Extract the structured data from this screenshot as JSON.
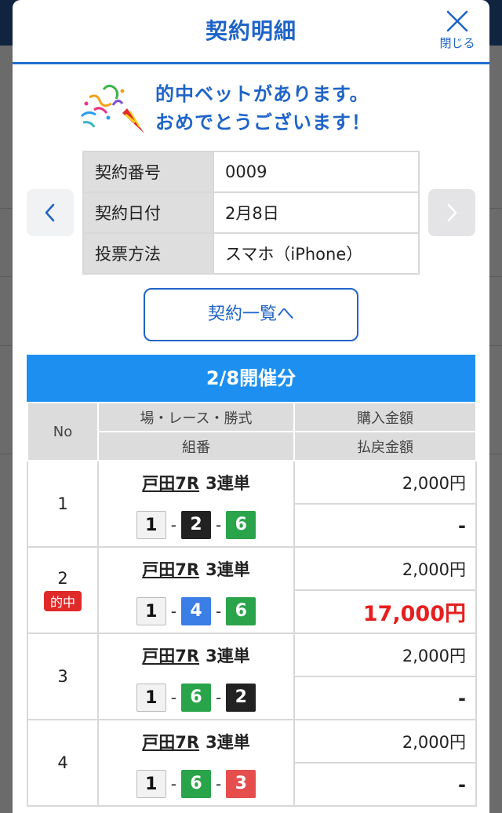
{
  "modal": {
    "title": "契約明細",
    "close_label": "閉じる"
  },
  "celebration": {
    "line1": "的中ベットがあります。",
    "line2": "おめでとうございます！"
  },
  "contract_info": {
    "rows": [
      {
        "label": "契約番号",
        "value": "0009"
      },
      {
        "label": "契約日付",
        "value": "2月8日"
      },
      {
        "label": "投票方法",
        "value": "スマホ（iPhone）"
      }
    ]
  },
  "list_button": "契約一覧へ",
  "session_title": "2/8開催分",
  "table_headers": {
    "no": "No",
    "venue": "場・レース・勝式",
    "combination": "組番",
    "purchase": "購入金額",
    "payout": "払戻金額"
  },
  "bets": [
    {
      "no": "1",
      "race": "戸田7R",
      "type": "3連単",
      "combo": [
        "1",
        "2",
        "6"
      ],
      "purchase": "2,000円",
      "payout": "-",
      "hit": false
    },
    {
      "no": "2",
      "badge": "的中",
      "race": "戸田7R",
      "type": "3連単",
      "combo": [
        "1",
        "4",
        "6"
      ],
      "purchase": "2,000円",
      "payout": "17,000円",
      "hit": true
    },
    {
      "no": "3",
      "race": "戸田7R",
      "type": "3連単",
      "combo": [
        "1",
        "6",
        "2"
      ],
      "purchase": "2,000円",
      "payout": "-",
      "hit": false
    },
    {
      "no": "4",
      "race": "戸田7R",
      "type": "3連単",
      "combo": [
        "1",
        "6",
        "3"
      ],
      "purchase": "2,000円",
      "payout": "-",
      "hit": false
    }
  ],
  "colors": {
    "accent": "#1f64c8",
    "session_bar": "#1d8ff0",
    "hit_red": "#e61e1e",
    "boat_1": "#f2f2f2",
    "boat_2": "#222222",
    "boat_3": "#e64e4e",
    "boat_4": "#3a7ee6",
    "boat_6": "#2aa44a"
  }
}
